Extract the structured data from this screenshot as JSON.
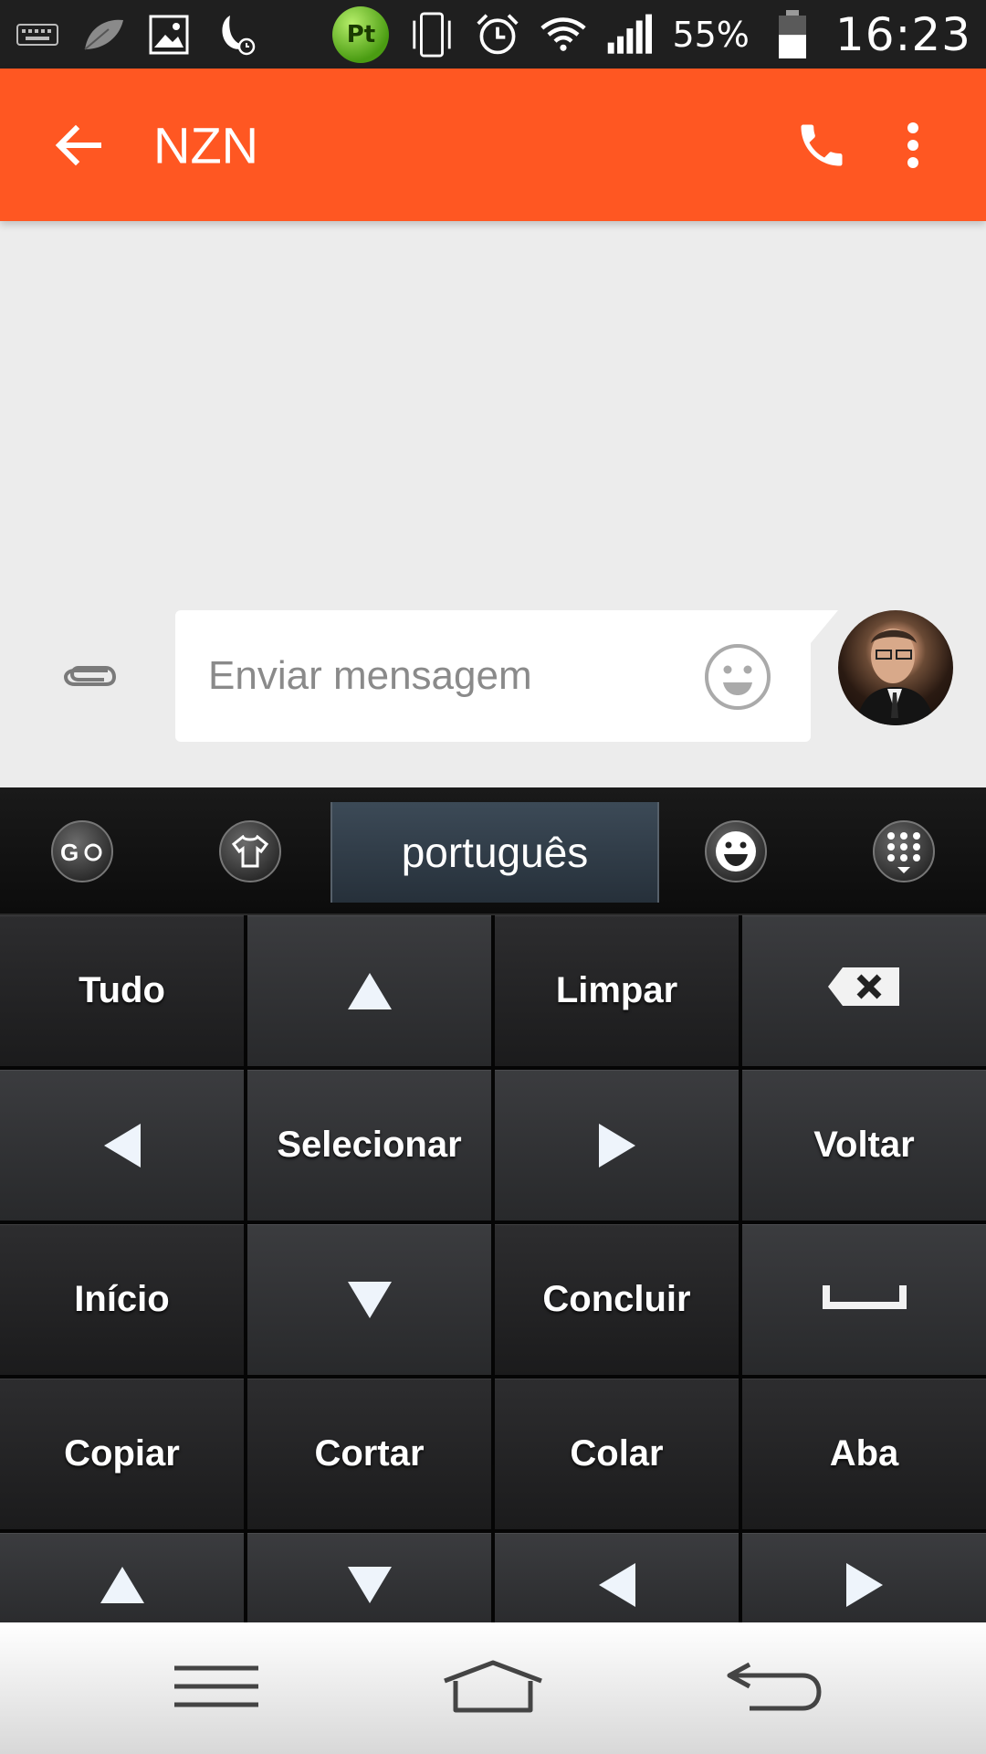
{
  "status_bar": {
    "left_icons": [
      "keyboard-icon",
      "leaf-icon",
      "image-icon",
      "night-mode-icon"
    ],
    "pt_badge": "Pt",
    "right_icons": [
      "vibrate-icon",
      "alarm-icon",
      "wifi-icon",
      "signal-icon"
    ],
    "battery_percent": "55%",
    "battery_level": 0.55,
    "time": "16:23"
  },
  "app_bar": {
    "title": "NZN",
    "color": "#ff5722",
    "icons": [
      "back-arrow-icon",
      "phone-icon",
      "more-vert-icon"
    ]
  },
  "composer": {
    "placeholder": "Enviar mensagem",
    "icons": [
      "paperclip-icon",
      "emoji-icon"
    ]
  },
  "keyboard": {
    "toolbar": {
      "language": "português",
      "icons": [
        "go-keyboard-icon",
        "theme-shirt-icon",
        "emoji-face-icon",
        "keypad-icon"
      ]
    },
    "keys": [
      {
        "label": "Tudo",
        "name": "key-select-all"
      },
      {
        "label": "",
        "name": "key-up-arrow",
        "icon": "up"
      },
      {
        "label": "Limpar",
        "name": "key-clear"
      },
      {
        "label": "",
        "name": "key-backspace",
        "icon": "backspace"
      },
      {
        "label": "",
        "name": "key-left-arrow",
        "icon": "left"
      },
      {
        "label": "Selecionar",
        "name": "key-select"
      },
      {
        "label": "",
        "name": "key-right-arrow",
        "icon": "right"
      },
      {
        "label": "Voltar",
        "name": "key-back"
      },
      {
        "label": "Início",
        "name": "key-home"
      },
      {
        "label": "",
        "name": "key-down-arrow",
        "icon": "down"
      },
      {
        "label": "Concluir",
        "name": "key-done"
      },
      {
        "label": "",
        "name": "key-space",
        "icon": "space"
      },
      {
        "label": "Copiar",
        "name": "key-copy"
      },
      {
        "label": "Cortar",
        "name": "key-cut"
      },
      {
        "label": "Colar",
        "name": "key-paste"
      },
      {
        "label": "Aba",
        "name": "key-tab"
      },
      {
        "label": "",
        "name": "key-page-up",
        "icon": "up"
      },
      {
        "label": "",
        "name": "key-page-down",
        "icon": "down"
      },
      {
        "label": "",
        "name": "key-line-start",
        "icon": "left"
      },
      {
        "label": "",
        "name": "key-line-end",
        "icon": "right"
      }
    ]
  },
  "nav_bar": {
    "icons": [
      "menu-icon",
      "home-icon",
      "back-icon"
    ]
  }
}
